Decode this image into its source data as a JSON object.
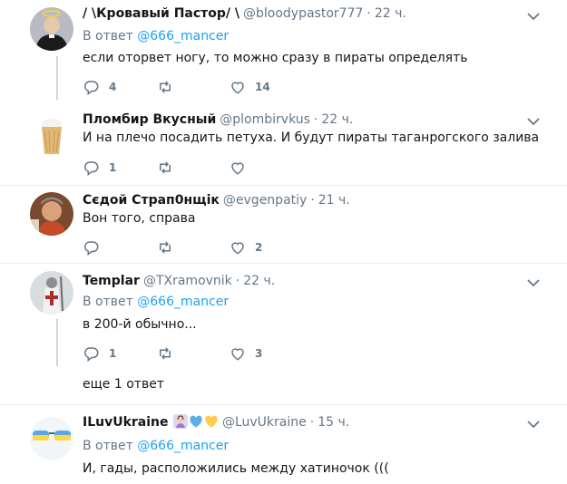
{
  "tweets": [
    {
      "name": "/ \\Кровавый Пастор/ \\",
      "handle": "@bloodypastor777",
      "time": "22 ч.",
      "reply_prefix": "В ответ",
      "reply_to": "@666_mancer",
      "text": "если оторвет ногу, то можно сразу в пираты определять",
      "replies": "4",
      "retweets": "",
      "likes": "14"
    },
    {
      "name": "Пломбир Вкусный",
      "handle": "@plombirvkus",
      "time": "22 ч.",
      "text": "И на плечо посадить петуха. И будут пираты таганрогского залива",
      "replies": "1",
      "retweets": "",
      "likes": ""
    },
    {
      "name": "Сєдой Страп0нщік",
      "handle": "@evgenpatiy",
      "time": "21 ч.",
      "text": "Вон того, справа",
      "replies": "",
      "retweets": "",
      "likes": "2"
    },
    {
      "name": "Templar",
      "handle": "@TXramovnik",
      "time": "22 ч.",
      "reply_prefix": "В ответ",
      "reply_to": "@666_mancer",
      "text": "в 200-й обычно...",
      "replies": "1",
      "retweets": "",
      "likes": "3"
    },
    {
      "name": "ILuvUkraine",
      "handle": "@LuvUkraine",
      "time": "15 ч.",
      "reply_prefix": "В ответ",
      "reply_to": "@666_mancer",
      "text": "И, гады, расположились между хатиночок (((",
      "replies": "",
      "retweets": "",
      "likes": ""
    }
  ],
  "more_replies_label": "еще 1 ответ",
  "icons": {
    "reply": "reply-icon",
    "retweet": "retweet-icon",
    "like": "heart-icon",
    "caret": "chevron-down-icon",
    "emojis": [
      "woman-emoji-icon",
      "blue-heart-icon",
      "yellow-heart-icon"
    ]
  },
  "colors": {
    "text": "#14171a",
    "secondary": "#657786",
    "link": "#1da1f2",
    "divider": "#e6ecf0",
    "thread_line": "#ccd6dd"
  }
}
